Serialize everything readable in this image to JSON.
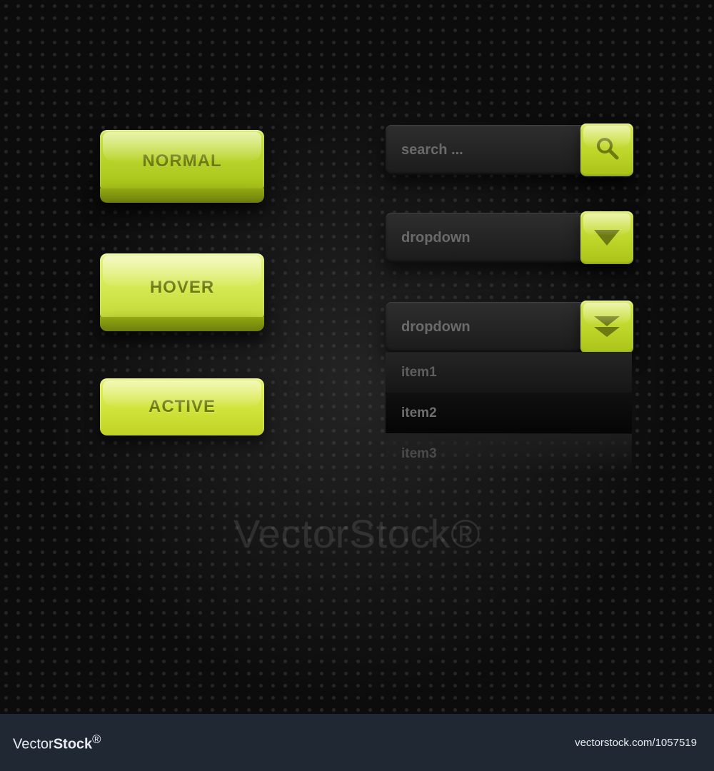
{
  "colors": {
    "accent": "#c3d72e",
    "accent_text": "#6d7a12"
  },
  "buttons": {
    "normal": "NORMAL",
    "hover": "HOVER",
    "active": "ACTIVE"
  },
  "search": {
    "placeholder": "search ..."
  },
  "dropdown_closed": {
    "label": "dropdown"
  },
  "dropdown_open": {
    "label": "dropdown",
    "items": [
      "item1",
      "item2",
      "item3"
    ]
  },
  "watermark": "VectorStock®",
  "footer": {
    "brand_light": "Vector",
    "brand_bold": "Stock",
    "url": "vectorstock.com/1057519"
  }
}
